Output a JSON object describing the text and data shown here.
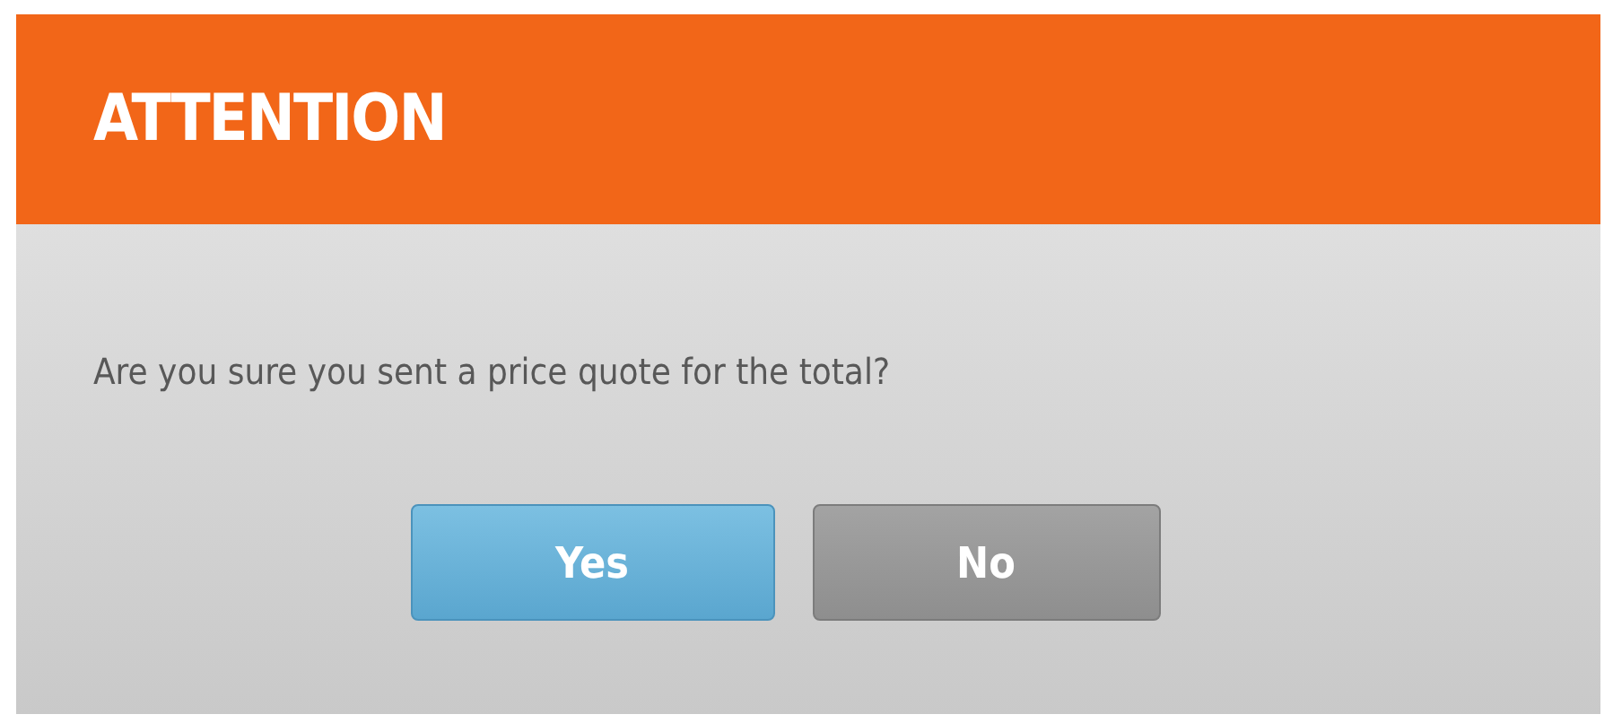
{
  "dialog": {
    "title": "ATTENTION",
    "message": "Are you sure you sent a price quote for the total?",
    "buttons": [
      {
        "label": "Yes",
        "kind": "primary"
      },
      {
        "label": "No",
        "kind": "secondary"
      }
    ]
  }
}
